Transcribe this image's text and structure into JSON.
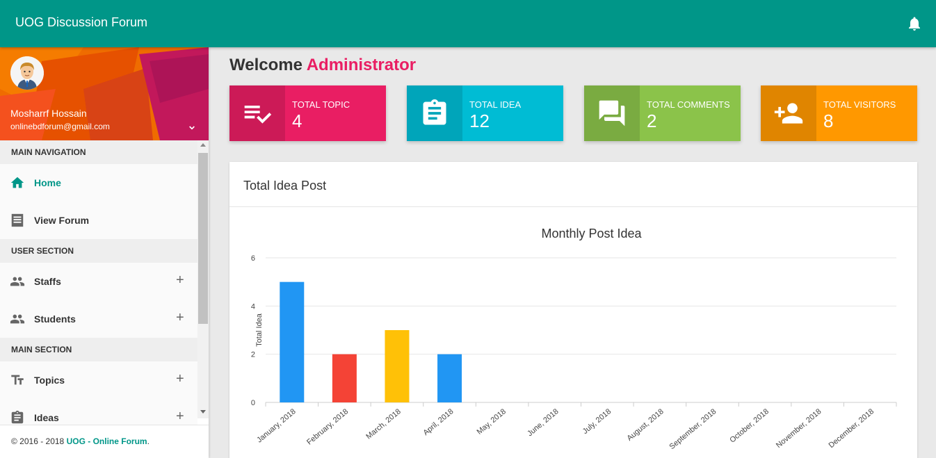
{
  "header": {
    "app_title": "UOG Discussion Forum",
    "notification_icon": "bell-icon"
  },
  "sidebar": {
    "user": {
      "name": "Mosharrf Hossain",
      "email": "onlinebdforum@gmail.com"
    },
    "sections": [
      {
        "title": "MAIN NAVIGATION"
      },
      {
        "title": "USER SECTION"
      },
      {
        "title": "MAIN SECTION"
      }
    ],
    "items": [
      {
        "label": "Home",
        "icon": "home-icon",
        "active": true
      },
      {
        "label": "View Forum",
        "icon": "list-icon"
      },
      {
        "label": "Staffs",
        "icon": "people-icon",
        "expand": "+"
      },
      {
        "label": "Students",
        "icon": "people-icon",
        "expand": "+"
      },
      {
        "label": "Topics",
        "icon": "text-icon",
        "expand": "+"
      },
      {
        "label": "Ideas",
        "icon": "clipboard-icon",
        "expand": "+"
      }
    ],
    "footer": {
      "copyright": "© 2016 - 2018 ",
      "link": "UOG - Online Forum",
      "end": "."
    }
  },
  "main": {
    "welcome": "Welcome",
    "role": "Administrator",
    "stats": [
      {
        "label": "TOTAL TOPIC",
        "value": "4",
        "icon": "playlist-check-icon",
        "color": "#e91e63"
      },
      {
        "label": "TOTAL IDEA",
        "value": "12",
        "icon": "clipboard-icon",
        "color": "#00bcd4"
      },
      {
        "label": "TOTAL COMMENTS",
        "value": "2",
        "icon": "forum-icon",
        "color": "#8bc34a"
      },
      {
        "label": "TOTAL VISITORS",
        "value": "8",
        "icon": "person-add-icon",
        "color": "#ff9800"
      }
    ],
    "chart_card_title": "Total Idea Post"
  },
  "chart_data": {
    "type": "bar",
    "title": "Monthly Post Idea",
    "xlabel": "",
    "ylabel": "Total Idea",
    "ylim": [
      0,
      6
    ],
    "yticks": [
      0,
      2,
      4,
      6
    ],
    "categories": [
      "January, 2018",
      "February, 2018",
      "March, 2018",
      "April, 2018",
      "May, 2018",
      "June, 2018",
      "July, 2018",
      "August, 2018",
      "September, 2018",
      "October, 2018",
      "November, 2018",
      "December, 2018"
    ],
    "values": [
      5,
      2,
      3,
      2,
      0,
      0,
      0,
      0,
      0,
      0,
      0,
      0
    ],
    "colors": [
      "#2196f3",
      "#f44336",
      "#ffc107",
      "#2196f3",
      "#2196f3",
      "#2196f3",
      "#2196f3",
      "#2196f3",
      "#2196f3",
      "#2196f3",
      "#2196f3",
      "#2196f3"
    ],
    "grid": true,
    "legend": "none"
  }
}
